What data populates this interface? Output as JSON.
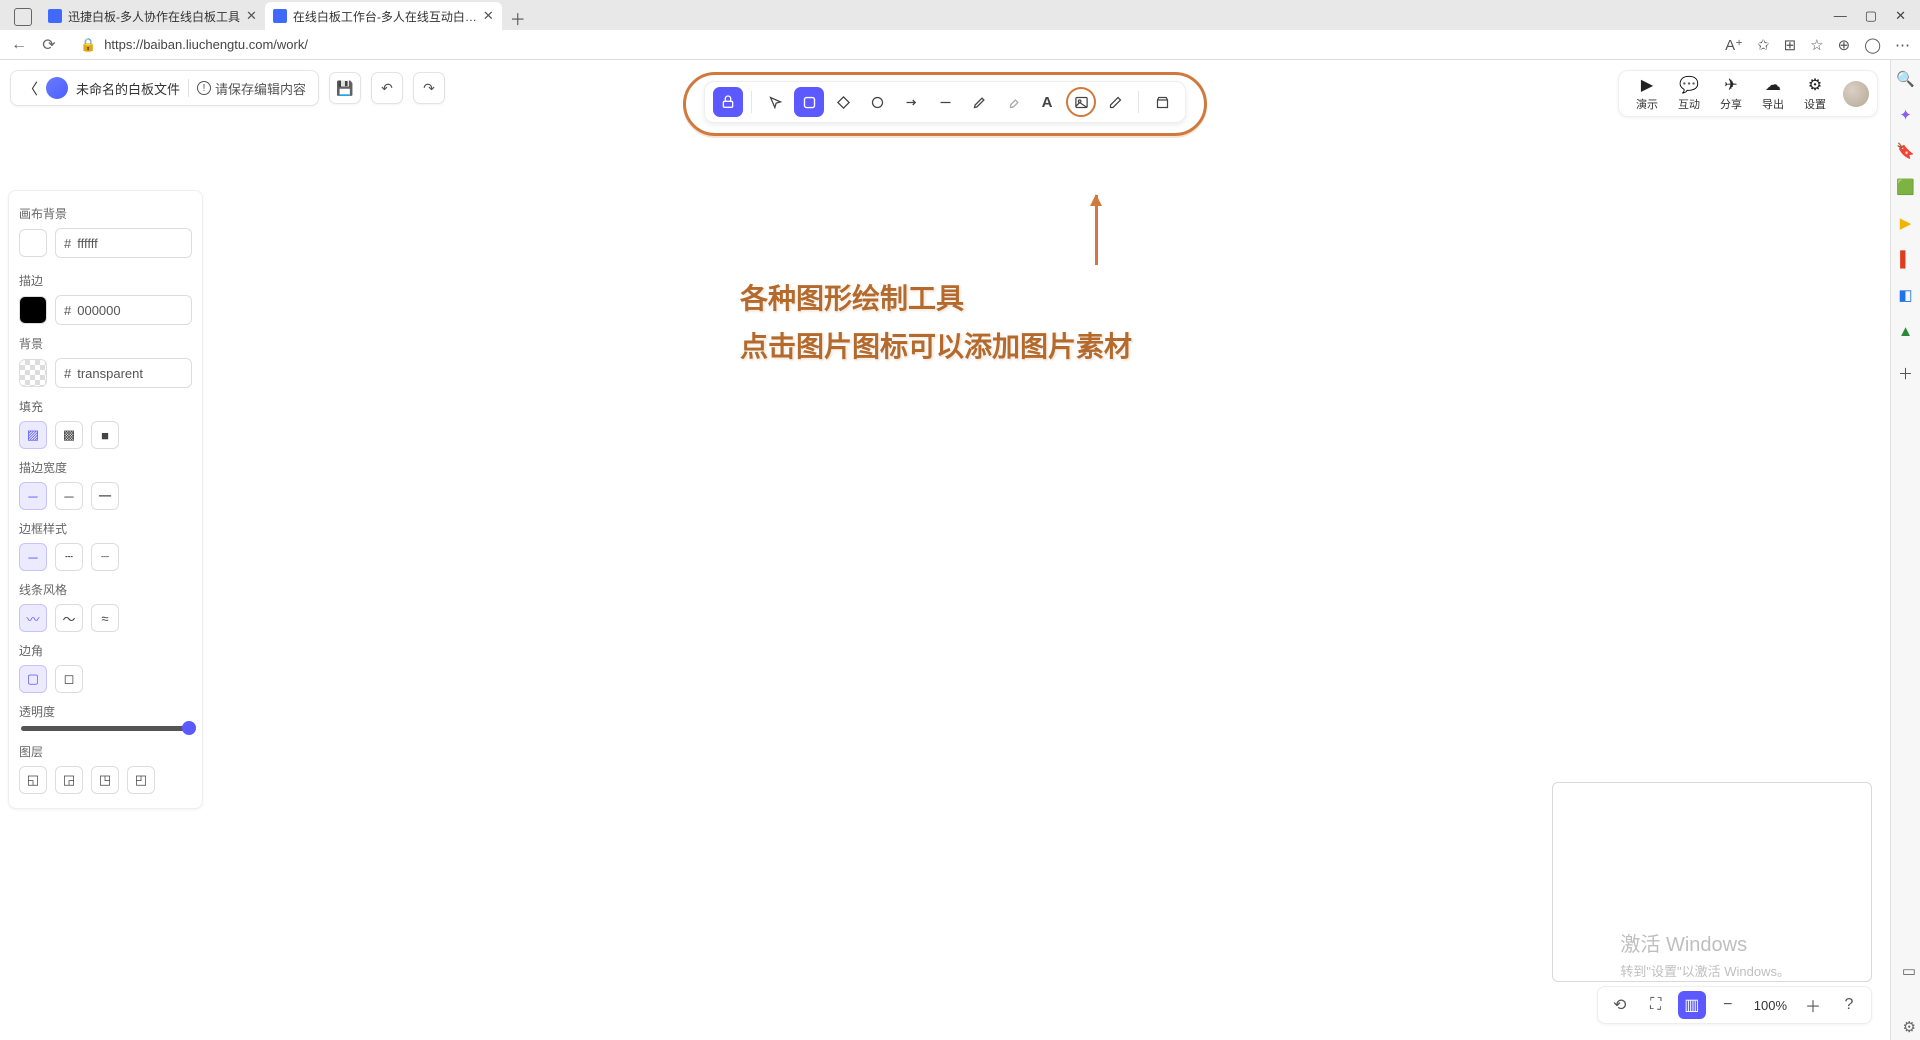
{
  "browser": {
    "tabs": [
      {
        "title": "迅捷白板-多人协作在线白板工具"
      },
      {
        "title": "在线白板工作台-多人在线互动白…"
      }
    ],
    "url": "https://baiban.liuchengtu.com/work/"
  },
  "header": {
    "filename": "未命名的白板文件",
    "save_hint": "请保存编辑内容"
  },
  "right_actions": {
    "present": "演示",
    "interact": "互动",
    "share": "分享",
    "export": "导出",
    "settings": "设置"
  },
  "annotation": {
    "line1": "各种图形绘制工具",
    "line2": "点击图片图标可以添加图片素材"
  },
  "panel": {
    "canvas_bg_label": "画布背景",
    "canvas_bg_hex": "ffffff",
    "stroke_label": "描边",
    "stroke_hex": "000000",
    "bg_label": "背景",
    "bg_hex": "transparent",
    "fill_label": "填充",
    "stroke_width_label": "描边宽度",
    "border_style_label": "边框样式",
    "line_style_label": "线条风格",
    "corner_label": "边角",
    "opacity_label": "透明度",
    "layer_label": "图层"
  },
  "zoom": {
    "value": "100%"
  },
  "watermark": {
    "l1": "激活 Windows",
    "l2": "转到\"设置\"以激活 Windows。"
  }
}
